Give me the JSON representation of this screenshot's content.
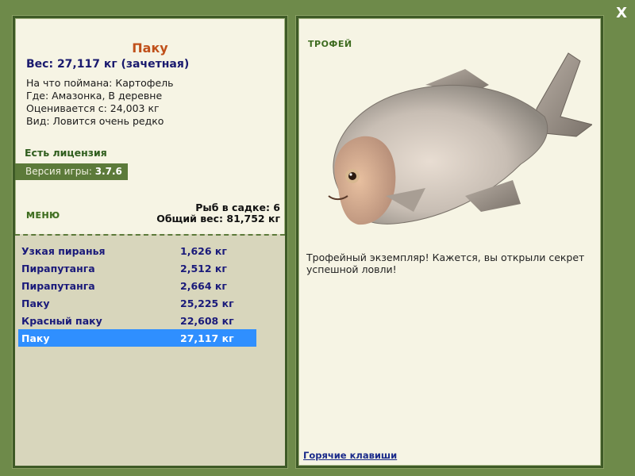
{
  "window": {
    "close_label": "X"
  },
  "fish_info": {
    "name": "Паку",
    "weight_line": "Вес: 27,117 кг (зачетная)",
    "caught_on": "На что поймана: Картофель",
    "location": "Где: Амазонка, В деревне",
    "valued_from": "Оценивается с: 24,003 кг",
    "rarity": "Вид: Ловится очень редко",
    "license": "Есть лицензия"
  },
  "version": {
    "label": "Версия игры:",
    "value": "3.7.6"
  },
  "menu": {
    "title": "МЕНЮ"
  },
  "stats": {
    "fish_in_cage": "Рыб в садке: 6",
    "total_weight": "Общий вес: 81,752 кг"
  },
  "catch_list": [
    {
      "name": "Узкая пиранья",
      "weight": "1,626 кг"
    },
    {
      "name": "Пирапутанга",
      "weight": "2,512 кг"
    },
    {
      "name": "Пирапутанга",
      "weight": "2,664 кг"
    },
    {
      "name": "Паку",
      "weight": "25,225 кг"
    },
    {
      "name": "Красный паку",
      "weight": "22,608 кг"
    },
    {
      "name": "Паку",
      "weight": "27,117 кг"
    }
  ],
  "selected_index": 5,
  "trophy": {
    "title": "ТРОФЕЙ",
    "message": "Трофейный экземпляр! Кажется, вы открыли секрет успешной ловли!",
    "hotkeys_link": "Горячие клавиши"
  },
  "colors": {
    "background": "#6e8a4a",
    "panel": "#f6f4e4",
    "selection": "#2f8fff",
    "fish_name": "#c0501a"
  }
}
